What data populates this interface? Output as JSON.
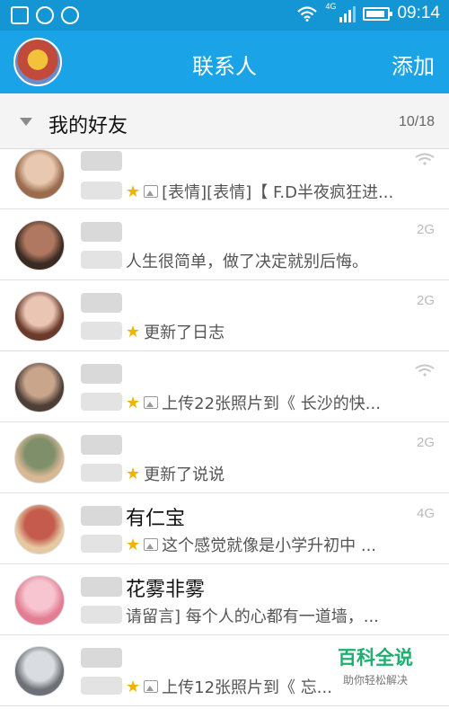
{
  "status_bar": {
    "network_type": "4G",
    "time": "09:14"
  },
  "header": {
    "title": "联系人",
    "add_label": "添加"
  },
  "group": {
    "name": "我的好友",
    "count": "10/18"
  },
  "contacts": [
    {
      "name": "",
      "starred": true,
      "has_image": true,
      "status_text": "[表情][表情]【 F.D半夜疯狂进...",
      "network": "wifi",
      "avatar_colors": [
        "#e8c8b0",
        "#9a6b4c"
      ]
    },
    {
      "name": "",
      "starred": false,
      "has_image": false,
      "status_text": "人生很简单，做了决定就别后悔。",
      "network": "2G",
      "avatar_colors": [
        "#b07860",
        "#3a2a22"
      ]
    },
    {
      "name": "",
      "starred": true,
      "has_image": false,
      "status_text": "更新了日志",
      "network": "2G",
      "avatar_colors": [
        "#eac5b3",
        "#6a3a2a"
      ]
    },
    {
      "name": "",
      "starred": true,
      "has_image": true,
      "status_text": "上传22张照片到《 长沙的快...",
      "network": "wifi",
      "avatar_colors": [
        "#c9a58c",
        "#4d3e36"
      ]
    },
    {
      "name": "",
      "starred": true,
      "has_image": false,
      "status_text": "更新了说说",
      "network": "2G",
      "avatar_colors": [
        "#7e8f6a",
        "#d9b896"
      ]
    },
    {
      "name": "有仁宝",
      "starred": true,
      "has_image": true,
      "status_text": "这个感觉就像是小学升初中 ...",
      "network": "4G",
      "avatar_colors": [
        "#c45b4d",
        "#e6c9a3"
      ]
    },
    {
      "name": "花雾非雾",
      "starred": false,
      "has_image": false,
      "status_text": "请留言] 每个人的心都有一道墙，...",
      "network": "",
      "avatar_colors": [
        "#f6c5cf",
        "#e27d93"
      ]
    },
    {
      "name": "",
      "starred": true,
      "has_image": true,
      "status_text": "上传12张照片到《 忘...",
      "network": "",
      "avatar_colors": [
        "#d9dce0",
        "#6d7076"
      ]
    }
  ],
  "watermark": {
    "main": "百科全说",
    "sub": "助你轻松解决"
  }
}
